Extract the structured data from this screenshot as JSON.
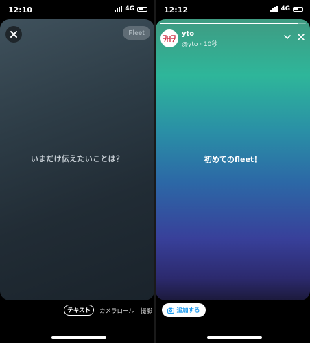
{
  "left": {
    "status": {
      "time": "12:10",
      "network": "4G"
    },
    "fleet_button": "Fleet",
    "prompt": "いまだけ伝えたいことは？",
    "tabs": [
      "テキスト",
      "カメラロール",
      "撮影"
    ]
  },
  "right": {
    "status": {
      "time": "12:12",
      "network": "4G"
    },
    "progress": 0.95,
    "user": {
      "avatar_text": "タリタ",
      "name": "yto",
      "meta": "@yto · 10秒"
    },
    "fleet_text": "初めてのfleet！",
    "add_button": "追加する"
  }
}
